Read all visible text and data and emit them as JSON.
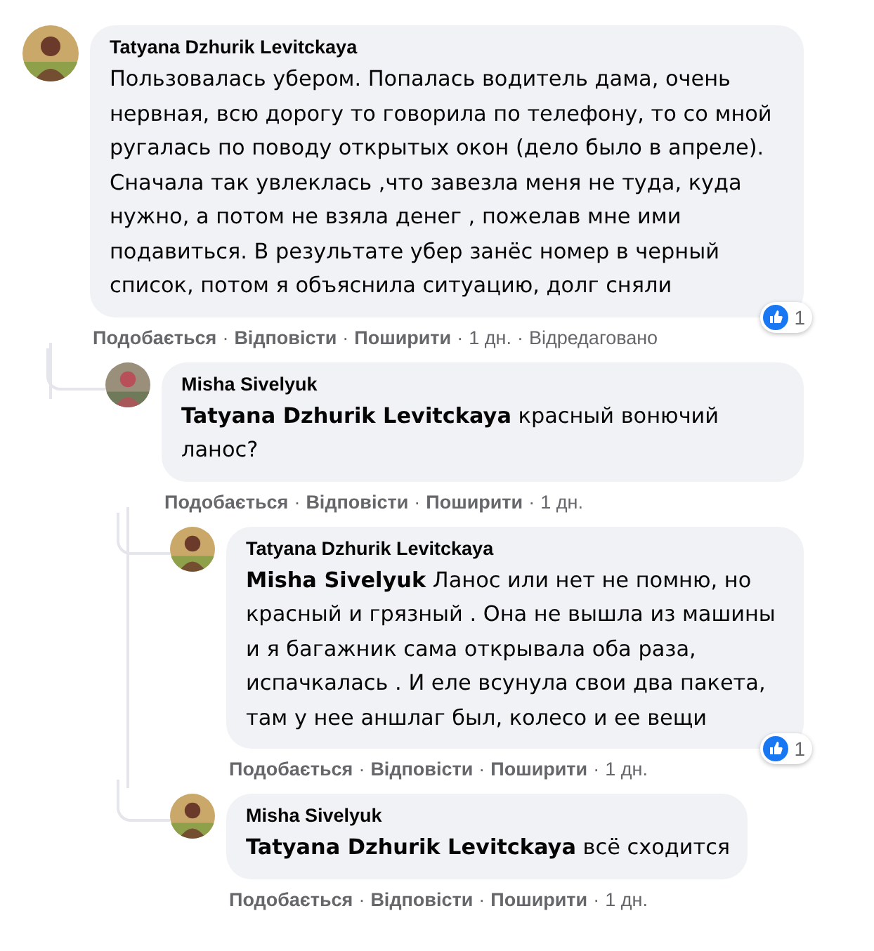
{
  "separator": "·",
  "comments": [
    {
      "author": "Tatyana Dzhurik Levitckaya",
      "avatar": {
        "kind": "picture"
      },
      "text": "Пользовалась убером. Попалась водитель дама, очень нервная, всю дорогу то говорила по телефону, то со мной ругалась по поводу открытых окон (дело было в апреле). Сначала так увлеклась ,что завезла меня не туда, куда нужно, а потом не взяла денег , пожелав мне ими подавиться. В результате убер занёс номер в черный список, потом я объяснила ситуацию, долг сняли",
      "reactions": "1",
      "actions": [
        "Подобається",
        "Відповісти",
        "Поширити"
      ],
      "time": "1 дн.",
      "edited": "Відредаговано",
      "children": [
        {
          "author": "Misha Sivelyuk",
          "avatar": {
            "kind": "picture"
          },
          "mention": "Tatyana Dzhurik Levitckaya",
          "text": "красный вонючий ланос?",
          "actions": [
            "Подобається",
            "Відповісти",
            "Поширити"
          ],
          "time": "1 дн.",
          "children": [
            {
              "author": "Tatyana Dzhurik Levitckaya",
              "avatar": {
                "kind": "picture"
              },
              "mention": "Misha Sivelyuk",
              "text": "Ланос или нет не помню, но красный и грязный . Она не вышла из машины и я багажник сама открывала оба раза, испачкалась . И еле всунула свои два пакета, там у нее аншлаг был, колесо и ее вещи",
              "reactions": "1",
              "actions": [
                "Подобається",
                "Відповісти",
                "Поширити"
              ],
              "time": "1 дн."
            },
            {
              "author": "Misha Sivelyuk",
              "avatar": {
                "kind": "picture"
              },
              "mention": "Tatyana Dzhurik Levitckaya",
              "text": "всё сходится",
              "actions": [
                "Подобається",
                "Відповісти",
                "Поширити"
              ],
              "time": "1 дн."
            }
          ]
        }
      ]
    }
  ]
}
